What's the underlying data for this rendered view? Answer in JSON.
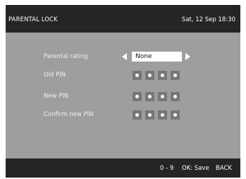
{
  "header": {
    "title": "PARENTAL LOCK",
    "datetime": "Sat, 12 Sep 18:30"
  },
  "form": {
    "parental_rating": {
      "label": "Parental rating",
      "value": "None"
    },
    "old_pin": {
      "label": "Old PIN",
      "digits": 4
    },
    "new_pin": {
      "label": "New PIN",
      "digits": 4
    },
    "confirm_pin": {
      "label": "Confirm new PIN",
      "digits": 4
    }
  },
  "footer": {
    "digits_hint": "0 - 9",
    "ok_hint": "OK: Save",
    "back_hint": "BACK"
  },
  "colors": {
    "background": "#9e9e9e",
    "bars": "#252525",
    "pin_box": "#777777"
  }
}
